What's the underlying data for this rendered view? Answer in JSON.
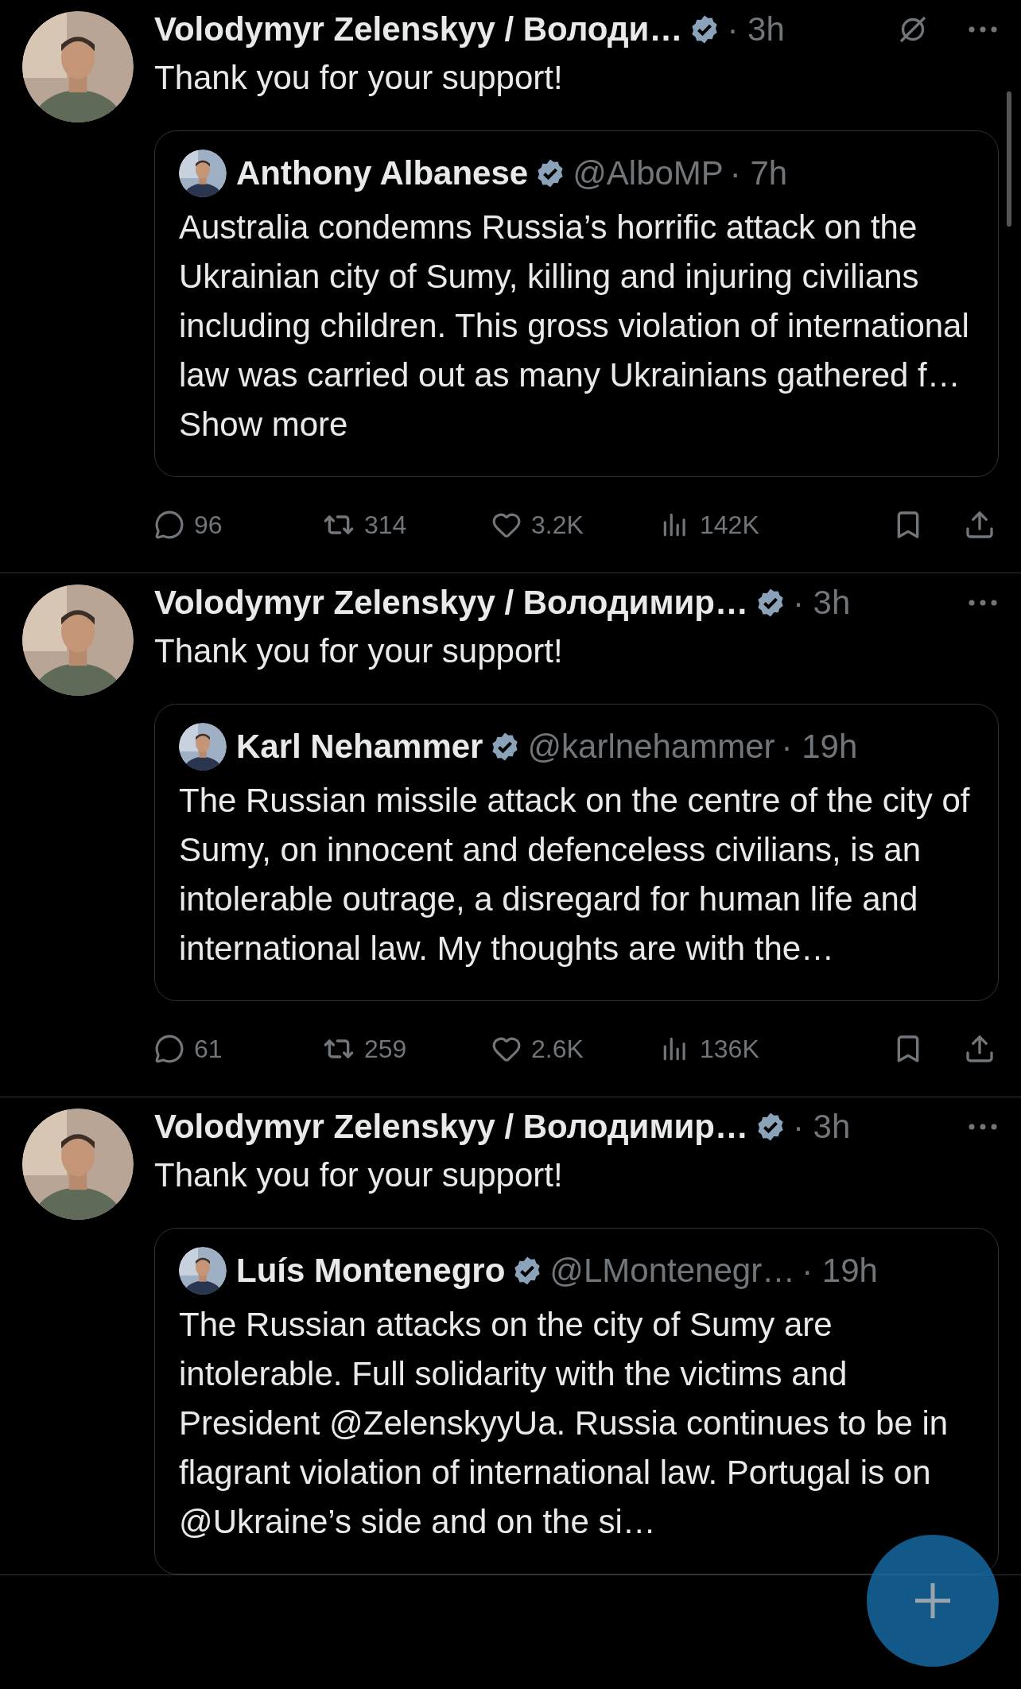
{
  "tweets": [
    {
      "author": "Volodymyr Zelenskyy / Володи…",
      "verified": true,
      "time": "· 3h",
      "grok": true,
      "text": "Thank you for your support!",
      "quote": {
        "author": "Anthony Albanese",
        "verified": true,
        "handle": "@AlboMP",
        "time": "· 7h",
        "text": "Australia condemns Russia’s horrific attack on the Ukrainian city of Sumy, killing and injuring civilians including children. This gross violation of international law was carried out as many Ukrainians gathered f… Show more"
      },
      "stats": {
        "replies": "96",
        "reposts": "314",
        "likes": "3.2K",
        "views": "142K"
      }
    },
    {
      "author": "Volodymyr Zelenskyy / Володимир…",
      "verified": true,
      "time": "· 3h",
      "grok": false,
      "text": "Thank you for your support!",
      "quote": {
        "author": "Karl Nehammer",
        "verified": true,
        "handle": "@karlnehammer",
        "time": "· 19h",
        "text": "The Russian missile attack on the centre of the city of Sumy, on innocent and defenceless civilians, is an intolerable outrage, a disregard for human life and international law. My thoughts are with the…"
      },
      "stats": {
        "replies": "61",
        "reposts": "259",
        "likes": "2.6K",
        "views": "136K"
      }
    },
    {
      "author": "Volodymyr Zelenskyy / Володимир…",
      "verified": true,
      "time": "· 3h",
      "grok": false,
      "text": "Thank you for your support!",
      "quote": {
        "author": "Luís Montenegro",
        "verified": true,
        "handle": "@LMontenegr…",
        "time": "· 19h",
        "text": "The Russian attacks on the city of Sumy are intolerable. Full solidarity with the victims and President @ZelenskyyUa. Russia continues to be in flagrant violation of international law. Portugal is on @Ukraine’s side and on the si…"
      }
    }
  ],
  "compose_button": {
    "kind": "plus"
  }
}
